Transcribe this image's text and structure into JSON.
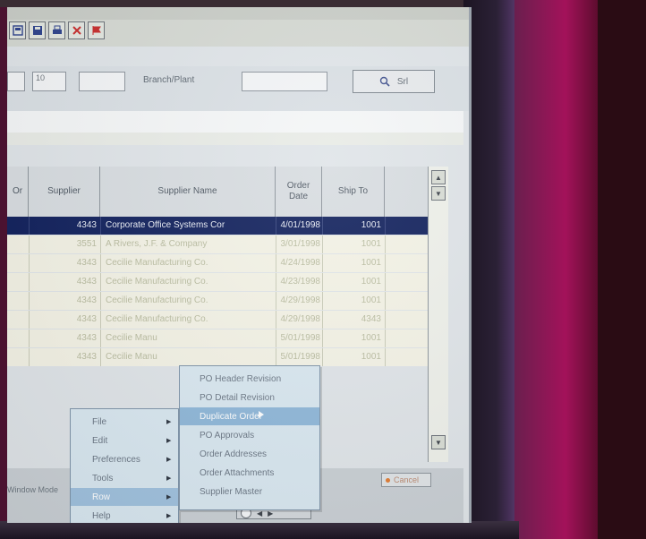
{
  "toolbar": {
    "buttons": [
      {
        "name": "layout-icon",
        "color": "#2a3f8a"
      },
      {
        "name": "save-icon",
        "color": "#2a3f8a"
      },
      {
        "name": "print-icon",
        "color": "#2a3f8a"
      },
      {
        "name": "delete-icon",
        "color": "#c62828"
      },
      {
        "name": "flag-icon",
        "color": "#c62828"
      }
    ]
  },
  "filters": {
    "field_a": "",
    "field_b": "10",
    "field_c": "",
    "branch_label": "Branch/Plant",
    "branch_value": "",
    "find_label": "Srl"
  },
  "table": {
    "headers": [
      "Or",
      "Supplier",
      "Supplier Name",
      "Order Date",
      "Ship To"
    ],
    "rows": [
      {
        "supplier": "4343",
        "name": "Corporate Office Systems Cor",
        "date": "4/01/1998",
        "ship": "1001",
        "selected": true
      },
      {
        "supplier": "3551",
        "name": "A Rivers, J.F. & Company",
        "date": "3/01/1998",
        "ship": "1001",
        "selected": false
      },
      {
        "supplier": "4343",
        "name": "Cecilie Manufacturing Co.",
        "date": "4/24/1998",
        "ship": "1001",
        "selected": false
      },
      {
        "supplier": "4343",
        "name": "Cecilie Manufacturing Co.",
        "date": "4/23/1998",
        "ship": "1001",
        "selected": false
      },
      {
        "supplier": "4343",
        "name": "Cecilie Manufacturing Co.",
        "date": "4/29/1998",
        "ship": "1001",
        "selected": false
      },
      {
        "supplier": "4343",
        "name": "Cecilie Manufacturing Co.",
        "date": "4/29/1998",
        "ship": "4343",
        "selected": false
      },
      {
        "supplier": "4343",
        "name": "Cecilie Manu",
        "date": "5/01/1998",
        "ship": "1001",
        "selected": false
      },
      {
        "supplier": "4343",
        "name": "Cecilie Manu",
        "date": "5/01/1998",
        "ship": "1001",
        "selected": false
      }
    ]
  },
  "context_menu": {
    "items": [
      {
        "label": "File",
        "highlighted": false
      },
      {
        "label": "Edit",
        "highlighted": false
      },
      {
        "label": "Preferences",
        "highlighted": false
      },
      {
        "label": "Tools",
        "highlighted": false
      },
      {
        "label": "Row",
        "highlighted": true
      },
      {
        "label": "Help",
        "highlighted": false
      }
    ]
  },
  "submenu": {
    "items": [
      {
        "label": "PO Header Revision",
        "highlighted": false
      },
      {
        "label": "PO Detail Revision",
        "highlighted": false
      },
      {
        "label": "Duplicate Order",
        "highlighted": true
      },
      {
        "label": "PO Approvals",
        "highlighted": false
      },
      {
        "label": "Order Addresses",
        "highlighted": false
      },
      {
        "label": "Order Attachments",
        "highlighted": false
      },
      {
        "label": "Supplier Master",
        "highlighted": false
      }
    ]
  },
  "status": {
    "left_text": "Window Mode",
    "right_text": "Cancel"
  },
  "colors": {
    "selected_row": "#0d1d5a",
    "menu_highlight": "#9fc1de",
    "bezel_magenta": "#a3125a"
  }
}
